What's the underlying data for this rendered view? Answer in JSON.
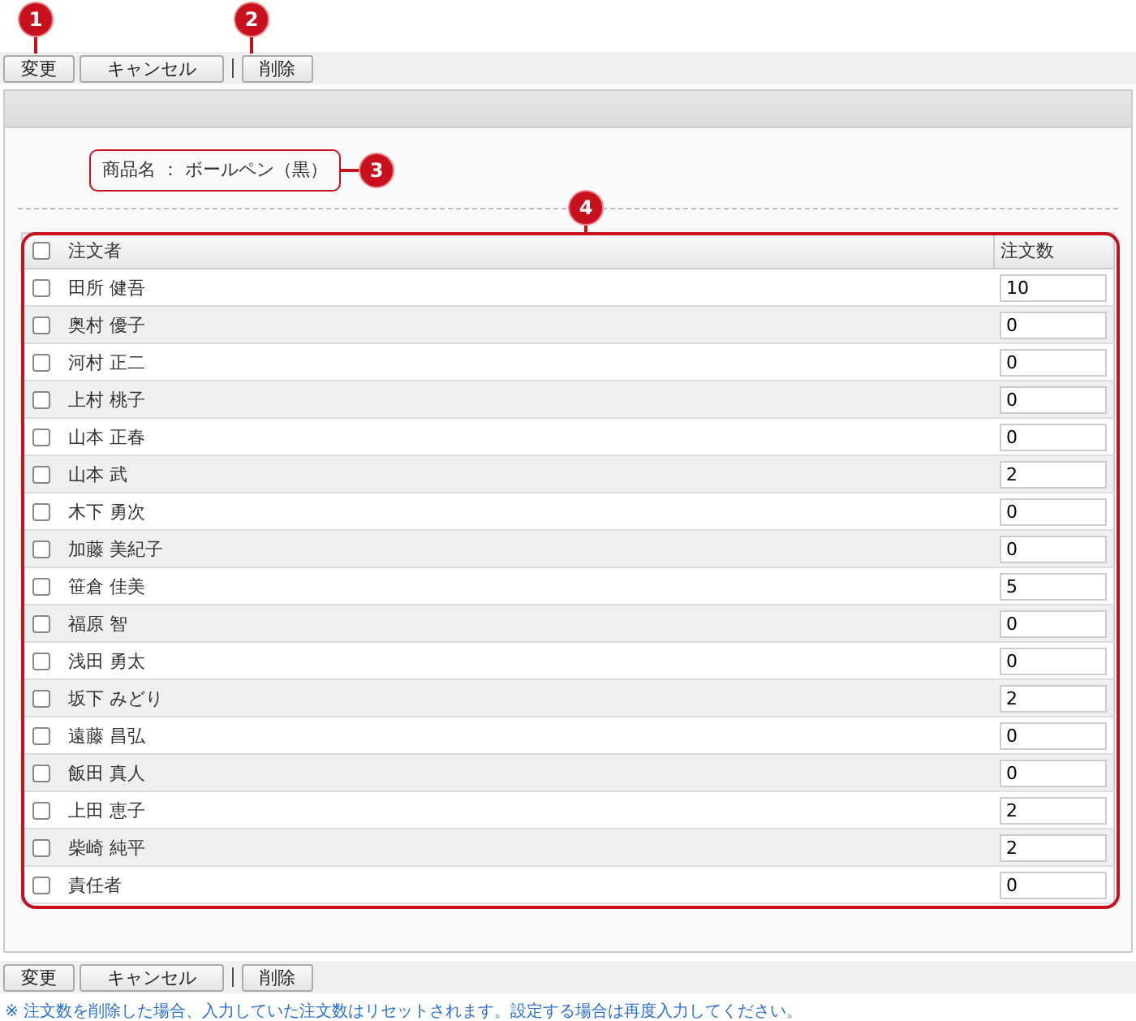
{
  "toolbar_top": [
    {
      "label": "変更",
      "callout": "1"
    },
    {
      "label": "キャンセル"
    },
    {
      "label": "削除",
      "callout": "2"
    }
  ],
  "product": {
    "label": "商品名",
    "separator": "：",
    "value": "ボールペン（黒）",
    "callout": "3"
  },
  "table": {
    "callout": "4",
    "header_checked": false,
    "columns": [
      "注文者",
      "注文数"
    ],
    "rows": [
      {
        "name": "田所 健吾",
        "qty": "10",
        "checked": false
      },
      {
        "name": "奥村 優子",
        "qty": "0",
        "checked": false
      },
      {
        "name": "河村 正二",
        "qty": "0",
        "checked": false
      },
      {
        "name": "上村 桃子",
        "qty": "0",
        "checked": false
      },
      {
        "name": "山本 正春",
        "qty": "0",
        "checked": false
      },
      {
        "name": "山本 武",
        "qty": "2",
        "checked": false
      },
      {
        "name": "木下 勇次",
        "qty": "0",
        "checked": false
      },
      {
        "name": "加藤 美紀子",
        "qty": "0",
        "checked": false
      },
      {
        "name": "笹倉 佳美",
        "qty": "5",
        "checked": false
      },
      {
        "name": "福原 智",
        "qty": "0",
        "checked": false
      },
      {
        "name": "浅田 勇太",
        "qty": "0",
        "checked": false
      },
      {
        "name": "坂下 みどり",
        "qty": "2",
        "checked": false
      },
      {
        "name": "遠藤 昌弘",
        "qty": "0",
        "checked": false
      },
      {
        "name": "飯田 真人",
        "qty": "0",
        "checked": false
      },
      {
        "name": "上田 恵子",
        "qty": "2",
        "checked": false
      },
      {
        "name": "柴崎 純平",
        "qty": "2",
        "checked": false
      },
      {
        "name": "責任者",
        "qty": "0",
        "checked": false
      }
    ]
  },
  "toolbar_bottom": [
    {
      "label": "変更"
    },
    {
      "label": "キャンセル"
    },
    {
      "label": "削除"
    }
  ],
  "note": {
    "mark": "※",
    "text": "注文数を削除した場合、入力していた注文数はリセットされます。設定する場合は再度入力してください。"
  }
}
